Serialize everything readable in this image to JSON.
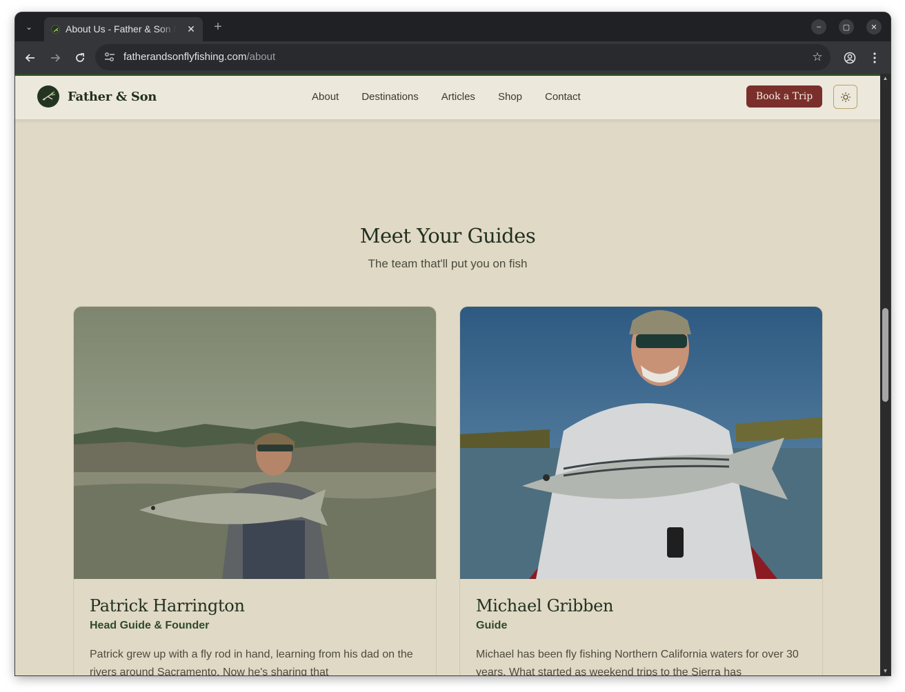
{
  "browser": {
    "tab_title": "About Us - Father & Son Fly Fishing",
    "url_domain": "fatherandsonflyfishing.com",
    "url_path": "/about",
    "icons": [
      "tab-search-icon",
      "favicon-icon",
      "close-icon",
      "new-tab-icon",
      "minimize-icon",
      "maximize-icon",
      "window-close-icon",
      "back-icon",
      "forward-icon",
      "reload-icon",
      "site-info-icon",
      "bookmark-star-icon",
      "profile-icon",
      "menu-icon"
    ]
  },
  "site": {
    "logo_text": "Father & Son",
    "nav": [
      "About",
      "Destinations",
      "Articles",
      "Shop",
      "Contact"
    ],
    "cta": "Book a Trip",
    "theme_icon": "sun-icon",
    "colors": {
      "brand_green": "#223021",
      "cta_red": "#7a2f2b",
      "background": "#e0d9c5",
      "nav_bg": "#ece8dc"
    }
  },
  "section": {
    "title": "Meet Your Guides",
    "subtitle": "The team that'll put you on fish"
  },
  "guides": [
    {
      "name": "Patrick Harrington",
      "role": "Head Guide & Founder",
      "bio": "Patrick grew up with a fly rod in hand, learning from his dad on the rivers around Sacramento. Now he's sharing that"
    },
    {
      "name": "Michael Gribben",
      "role": "Guide",
      "bio": "Michael has been fly fishing Northern California waters for over 30 years. What started as weekend trips to the Sierra has"
    }
  ]
}
